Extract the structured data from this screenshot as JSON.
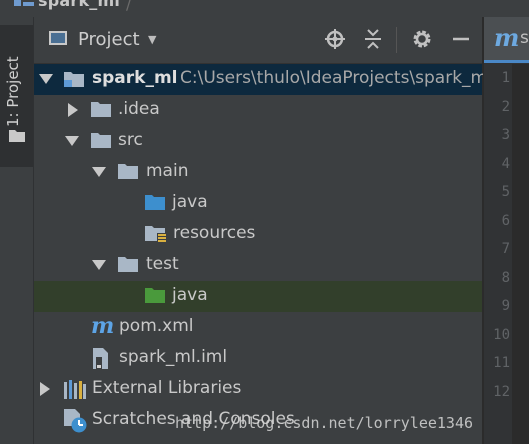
{
  "window": {
    "title": "spark_ml"
  },
  "tool_strip": {
    "tab_label": "1: Project"
  },
  "panel": {
    "title": "Project",
    "icons": [
      "target-icon",
      "collapse-all-icon",
      "gear-icon",
      "minimize-icon"
    ]
  },
  "tree": [
    {
      "label": "spark_ml",
      "path": "C:\\Users\\thulo\\IdeaProjects\\spark_ml",
      "expanded": true,
      "icon": "project-folder-icon",
      "selected": true
    },
    {
      "label": ".idea",
      "expanded": false,
      "icon": "folder-icon"
    },
    {
      "label": "src",
      "expanded": true,
      "icon": "folder-icon"
    },
    {
      "label": "main",
      "expanded": true,
      "icon": "folder-icon"
    },
    {
      "label": "java",
      "icon": "source-folder-icon"
    },
    {
      "label": "resources",
      "icon": "resources-folder-icon"
    },
    {
      "label": "test",
      "expanded": true,
      "icon": "folder-icon"
    },
    {
      "label": "java",
      "icon": "test-source-folder-icon",
      "highlighted": true
    },
    {
      "label": "pom.xml",
      "icon": "maven-icon"
    },
    {
      "label": "spark_ml.iml",
      "icon": "iml-file-icon"
    },
    {
      "label": "External Libraries",
      "expanded": false,
      "icon": "libraries-icon"
    },
    {
      "label": "Scratches and Consoles",
      "icon": "scratches-icon"
    }
  ],
  "editor": {
    "tab_label": "s",
    "line_numbers": [
      "1",
      "2",
      "3",
      "4",
      "5",
      "6",
      "7",
      "8",
      "9",
      "10",
      "11",
      "12"
    ]
  },
  "watermark": "http://blog.csdn.net/lorrylee1346"
}
